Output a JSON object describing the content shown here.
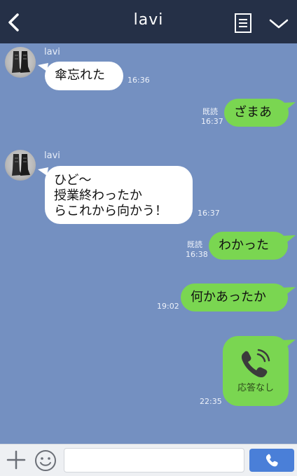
{
  "header": {
    "title": "lavi",
    "back_icon": "chevron-left-icon",
    "menu_icon": "note-icon",
    "dropdown_icon": "chevron-down-icon",
    "background_color": "#253047"
  },
  "chat": {
    "background_color": "#7490c1",
    "incoming_bubble_color": "#ffffff",
    "outgoing_bubble_color": "#7ad651",
    "messages": [
      {
        "direction": "in",
        "sender": "lavi",
        "lines": [
          "傘忘れた"
        ],
        "time": "16:36"
      },
      {
        "direction": "out",
        "lines": [
          "ざまあ"
        ],
        "read": "既読",
        "time": "16:37"
      },
      {
        "direction": "in",
        "sender": "lavi",
        "lines": [
          "ひど〜",
          "授業終わったか",
          "らこれから向かう！"
        ],
        "time": "16:37"
      },
      {
        "direction": "out",
        "lines": [
          "わかった"
        ],
        "read": "既読",
        "time": "16:38"
      },
      {
        "direction": "out",
        "lines": [
          "何かあったか"
        ],
        "time": "19:02"
      },
      {
        "direction": "out",
        "type": "call",
        "call_icon": "phone-ringing-icon",
        "label": "応答なし",
        "time": "22:35"
      }
    ]
  },
  "footer": {
    "plus_icon": "plus-icon",
    "emoji_icon": "smiley-icon",
    "input_value": "",
    "input_placeholder": "",
    "call_icon": "phone-icon",
    "call_button_color": "#4a7fd8"
  }
}
